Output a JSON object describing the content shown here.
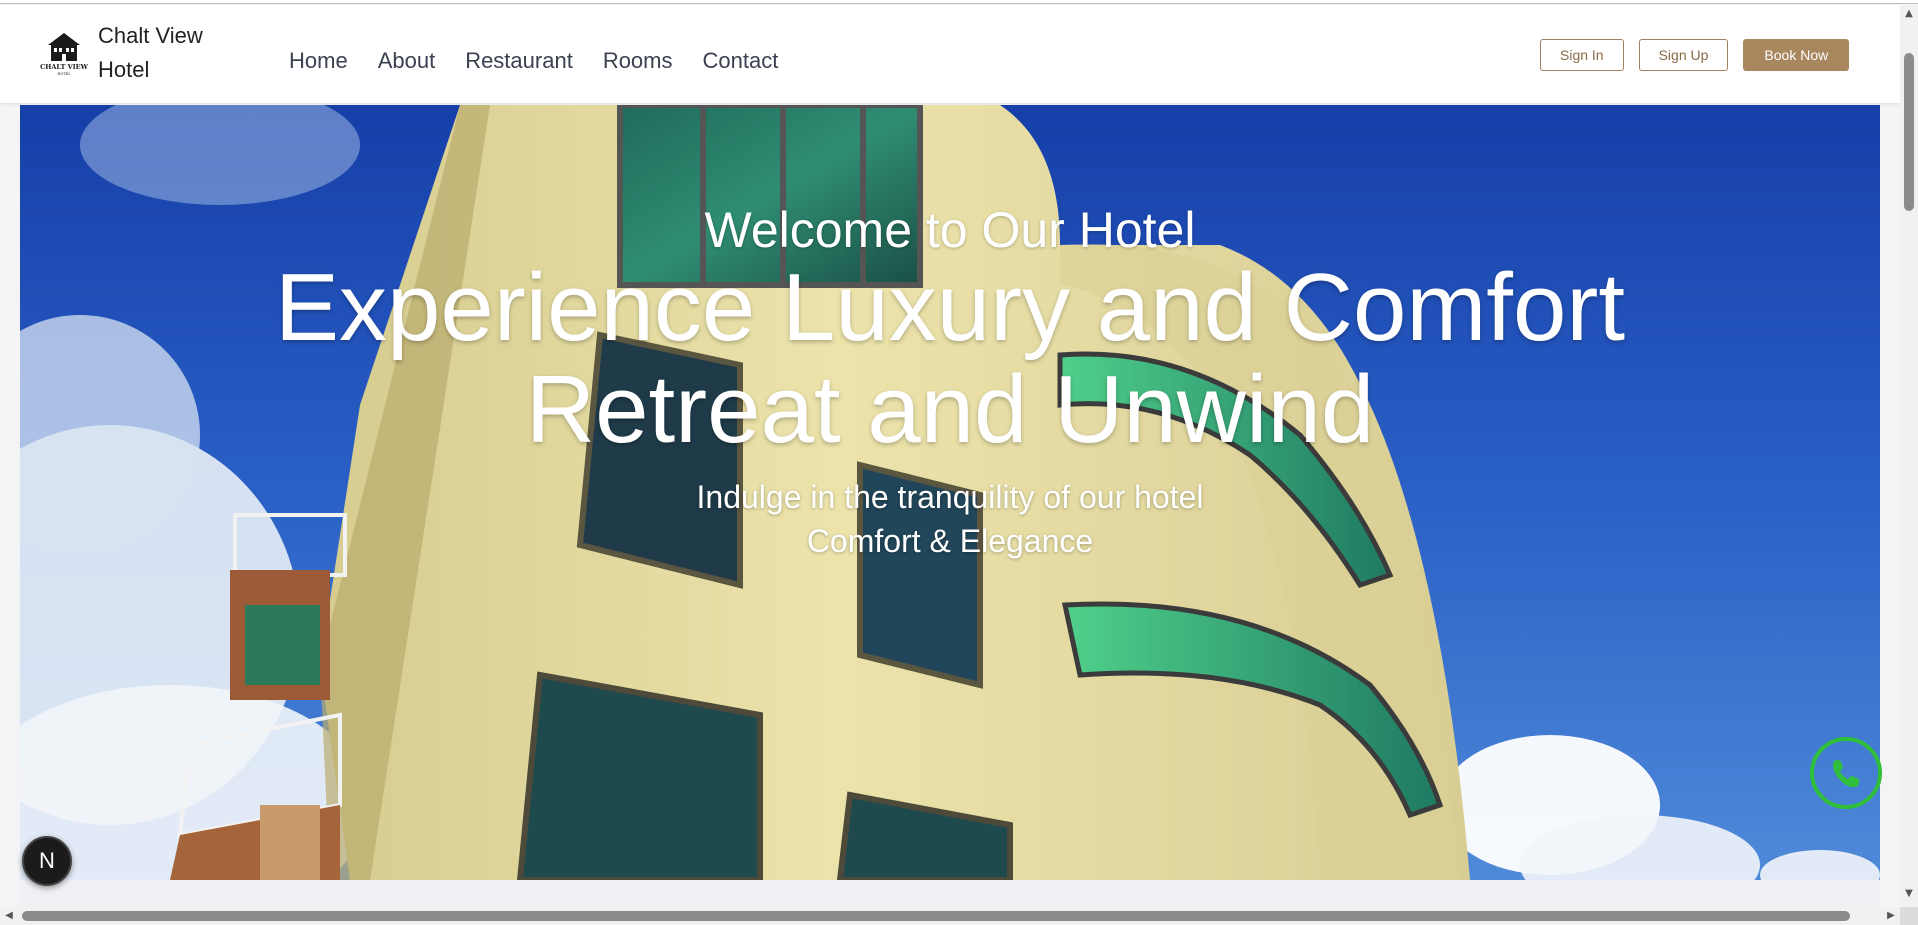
{
  "header": {
    "brand_line1": "Chalt View",
    "brand_line2": "Hotel",
    "logo_text": "CHALT VIEW",
    "logo_sub": "HOTEL",
    "nav": [
      "Home",
      "About",
      "Restaurant",
      "Rooms",
      "Contact"
    ],
    "sign_in": "Sign In",
    "sign_up": "Sign Up",
    "book_now": "Book Now"
  },
  "hero": {
    "welcome": "Welcome to Our Hotel",
    "headline_line1": "Experience Luxury and Comfort",
    "headline_line2": "Retreat and Unwind",
    "sub_line1": "Indulge in the tranquility of our hotel",
    "sub_line2": "Comfort & Elegance"
  },
  "widgets": {
    "whatsapp_icon": "whatsapp-phone-icon",
    "next_badge": "N"
  },
  "colors": {
    "accent": "#a8865e",
    "whatsapp": "#2fbf3b",
    "sky": "#1d47b4",
    "building": "#e9dfa7"
  }
}
